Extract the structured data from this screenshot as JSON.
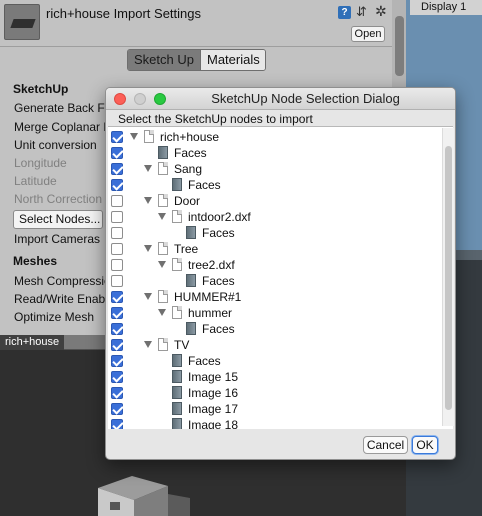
{
  "inspector": {
    "title": "rich+house Import Settings",
    "open_label": "Open",
    "help_glyph": "?",
    "preset_glyph": "⇵",
    "gear_glyph": "✲",
    "tabs": [
      "Sketch Up",
      "Materials"
    ],
    "sections": {
      "sketchup": "SketchUp",
      "meshes": "Meshes"
    },
    "fields": {
      "generate_back_faces": "Generate Back Fa",
      "merge_coplanar": "Merge Coplanar F",
      "unit_conversion": "Unit conversion",
      "longitude": "Longitude",
      "latitude": "Latitude",
      "north_correction": "North Correction",
      "select_nodes": "Select Nodes...",
      "import_cameras": "Import Cameras",
      "mesh_compression": "Mesh Compressio",
      "read_write_enabled": "Read/Write Enabl",
      "optimize_mesh": "Optimize Mesh"
    }
  },
  "display_panel": {
    "tab_label": "Display 1"
  },
  "scene": {
    "tab_label": "rich+house"
  },
  "dialog": {
    "title": "SketchUp Node Selection Dialog",
    "prompt": "Select the SketchUp nodes to import",
    "cancel_label": "Cancel",
    "ok_label": "OK",
    "nodes": [
      {
        "label": "rich+house",
        "checked": true,
        "depth": 0,
        "kind": "group",
        "expanded": true
      },
      {
        "label": "Faces",
        "checked": true,
        "depth": 1,
        "kind": "faces"
      },
      {
        "label": "Sang",
        "checked": true,
        "depth": 1,
        "kind": "group",
        "expanded": true
      },
      {
        "label": "Faces",
        "checked": true,
        "depth": 2,
        "kind": "faces"
      },
      {
        "label": "Door",
        "checked": false,
        "depth": 1,
        "kind": "group",
        "expanded": true
      },
      {
        "label": "intdoor2.dxf",
        "checked": false,
        "depth": 2,
        "kind": "group",
        "expanded": true
      },
      {
        "label": "Faces",
        "checked": false,
        "depth": 3,
        "kind": "faces"
      },
      {
        "label": "Tree",
        "checked": false,
        "depth": 1,
        "kind": "group",
        "expanded": true
      },
      {
        "label": "tree2.dxf",
        "checked": false,
        "depth": 2,
        "kind": "group",
        "expanded": true
      },
      {
        "label": "Faces",
        "checked": false,
        "depth": 3,
        "kind": "faces"
      },
      {
        "label": "HUMMER#1",
        "checked": true,
        "depth": 1,
        "kind": "group",
        "expanded": true
      },
      {
        "label": "hummer",
        "checked": true,
        "depth": 2,
        "kind": "group",
        "expanded": true
      },
      {
        "label": "Faces",
        "checked": true,
        "depth": 3,
        "kind": "faces"
      },
      {
        "label": "TV",
        "checked": true,
        "depth": 1,
        "kind": "group",
        "expanded": true
      },
      {
        "label": "Faces",
        "checked": true,
        "depth": 2,
        "kind": "faces"
      },
      {
        "label": "Image 15",
        "checked": true,
        "depth": 2,
        "kind": "faces"
      },
      {
        "label": "Image 16",
        "checked": true,
        "depth": 2,
        "kind": "faces"
      },
      {
        "label": "Image 17",
        "checked": true,
        "depth": 2,
        "kind": "faces"
      },
      {
        "label": "Image 18",
        "checked": true,
        "depth": 2,
        "kind": "faces"
      }
    ]
  },
  "colors": {
    "checkbox_checked": "#3a6fd8",
    "close_light": "#fc5f57",
    "zoom_light": "#29c941",
    "inspector_bg": "#c2c2c2"
  }
}
